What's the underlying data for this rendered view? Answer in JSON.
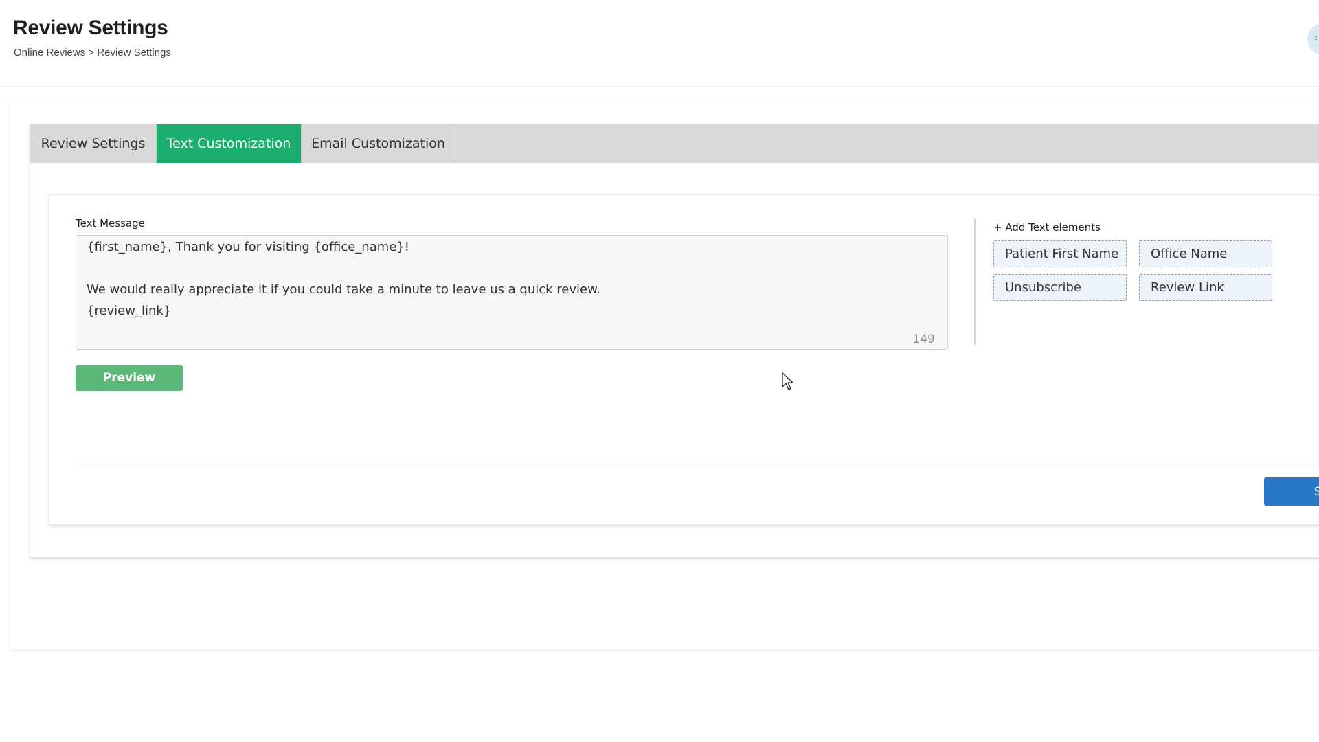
{
  "header": {
    "title": "Review Settings",
    "breadcrumb": "Online Reviews > Review Settings"
  },
  "tabs": [
    {
      "label": "Review Settings",
      "active": false
    },
    {
      "label": "Text Customization",
      "active": true
    },
    {
      "label": "Email Customization",
      "active": false
    }
  ],
  "text_message": {
    "label": "Text Message",
    "lines": [
      "{first_name}, Thank you for visiting {office_name}!",
      "",
      "We would really appreciate it if you could take a minute to leave us a quick review.",
      "{review_link}"
    ],
    "char_count": "149"
  },
  "preview_button": "Preview",
  "add_elements": {
    "label": "+ Add Text elements",
    "chips": [
      "Patient First Name",
      "Office Name",
      "Unsubscribe",
      "Review Link"
    ]
  },
  "save_button": "S",
  "colors": {
    "active_tab": "#1aae6f",
    "preview_button": "#5cb878",
    "save_button": "#2a78c8"
  }
}
